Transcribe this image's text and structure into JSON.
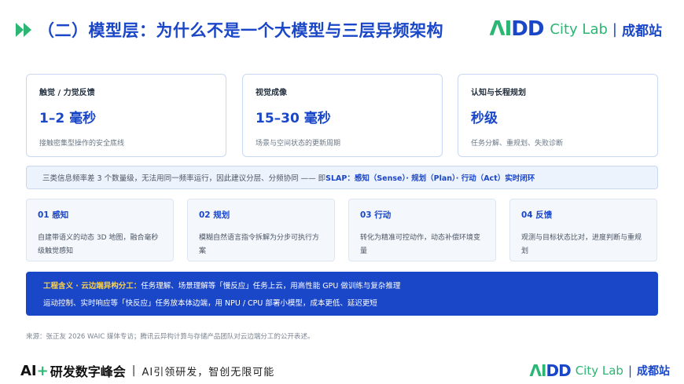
{
  "header": {
    "title": "（二）模型层：为什么不是一个大模型与三层异频架构",
    "brand": {
      "logo_a": "Λ",
      "logo_i": "I",
      "logo_dd": "DD",
      "city": "City Lab",
      "sep": "|",
      "site": "成都站"
    }
  },
  "metrics": [
    {
      "label": "触觉 / 力觉反馈",
      "value": "1–2 毫秒",
      "desc": "接触密集型操作的安全底线"
    },
    {
      "label": "视觉成像",
      "value": "15–30 毫秒",
      "desc": "场景与空间状态的更新周期"
    },
    {
      "label": "认知与长程规划",
      "value": "秒级",
      "desc": "任务分解、重规划、失败诊断"
    }
  ],
  "frequency": {
    "text": "三类信息频率差 3 个数量级，无法用同一频率运行，因此建议分层、分频协同 —— 即 ",
    "strong": "SLAP：感知（Sense）· 规划（Plan）· 行动（Act）实时闭环"
  },
  "steps": [
    {
      "title": "01 感知",
      "desc": "自建带语义的动态 3D 地图，融合毫秒级触觉感知"
    },
    {
      "title": "02 规划",
      "desc": "模糊自然语言指令拆解为分步可执行方案"
    },
    {
      "title": "03 行动",
      "desc": "转化为精准可控动作，动态补偿环境变量"
    },
    {
      "title": "04 反馈",
      "desc": "观测与目标状态比对，进度判断与重规划"
    }
  ],
  "engineering": {
    "key": "工程含义 · 云边端异构分工：",
    "line1": "任务理解、场景理解等「慢反应」任务上云，用高性能 GPU 做训练与复杂推理",
    "line2": "运动控制、实时响应等「快反应」任务放本体边端，用 NPU / CPU 部署小模型，成本更低、延迟更短"
  },
  "source": "来源：张正友 2026 WAIC 媒体专访；腾讯云异构计算与存储产品团队对云边端分工的公开表述。",
  "footer": {
    "ai": "AI",
    "plus": "+",
    "summit": "研发数字峰会",
    "sep": "|",
    "slogan": "AI引领研发，智创无限可能"
  },
  "colors": {
    "primary": "#1a46c8",
    "green": "#2bb673",
    "accent_yellow": "#f9d34c"
  }
}
